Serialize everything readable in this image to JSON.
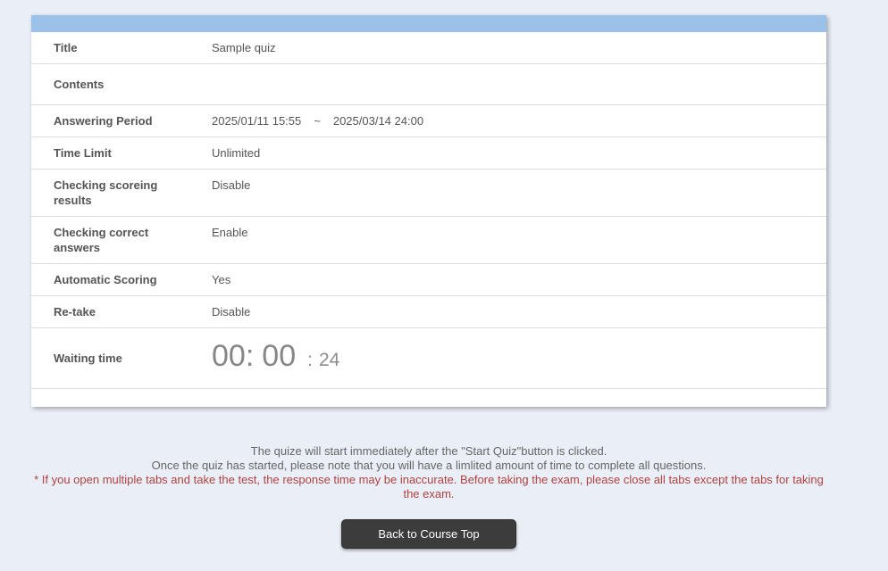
{
  "colors": {
    "page_background": "#eaeef7",
    "header_bar_blue": "#9ac2e9",
    "label_text": "#555555",
    "timer_text": "#868686",
    "note_text": "#666666",
    "warning_red": "#b04240",
    "button_background": "#3c3c3c"
  },
  "table": {
    "rows": [
      {
        "label": "Title",
        "value": "Sample quiz"
      },
      {
        "label": "Contents",
        "value": ""
      },
      {
        "label": "Answering Period",
        "value": {
          "from": "2025/01/11 15:55",
          "separator": "~",
          "to": "2025/03/14 24:00"
        }
      },
      {
        "label": "Time Limit",
        "value": "Unlimited"
      },
      {
        "label": "Checking scoreing results",
        "value": "Disable"
      },
      {
        "label": "Checking correct answers",
        "value": "Enable"
      },
      {
        "label": "Automatic Scoring",
        "value": "Yes"
      },
      {
        "label": "Re-take",
        "value": "Disable"
      },
      {
        "label": "Waiting time",
        "timer": {
          "hours": "00",
          "colon1": ":",
          "minutes": "00",
          "colon2": ":",
          "seconds": "24"
        }
      }
    ]
  },
  "notes": {
    "line1": "The quize will start immediately after the \"Start Quiz\"button is clicked.",
    "line2": "Once the quiz has started, please note that you will have a limlited amount of time to complete all questions.",
    "warning": "* If you open multiple tabs and take the test, the response time may be inaccurate. Before taking the exam, please close all tabs except the tabs for taking the exam."
  },
  "actions": {
    "back_button_label": "Back to Course Top"
  }
}
